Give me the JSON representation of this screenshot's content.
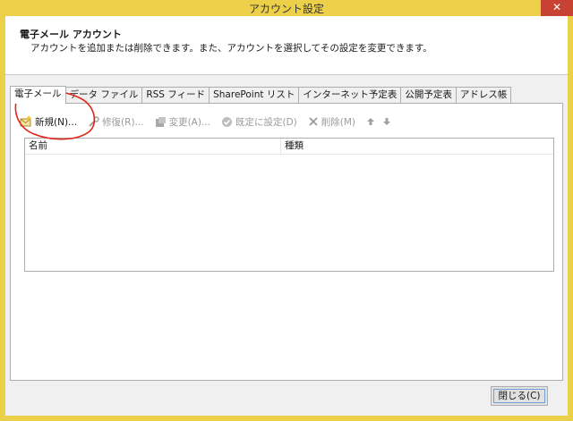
{
  "window": {
    "title": "アカウント設定",
    "close_glyph": "✕"
  },
  "header": {
    "title": "電子メール アカウント",
    "description": "アカウントを追加または削除できます。また、アカウントを選択してその設定を変更できます。"
  },
  "tabs": [
    {
      "label": "電子メール"
    },
    {
      "label": "データ ファイル"
    },
    {
      "label": "RSS フィード"
    },
    {
      "label": "SharePoint リスト"
    },
    {
      "label": "インターネット予定表"
    },
    {
      "label": "公開予定表"
    },
    {
      "label": "アドレス帳"
    }
  ],
  "toolbar": {
    "new_label": "新規(N)...",
    "repair_label": "修復(R)...",
    "change_label": "変更(A)...",
    "default_label": "既定に設定(D)",
    "delete_label": "削除(M)"
  },
  "list": {
    "columns": [
      "名前",
      "種類"
    ]
  },
  "footer": {
    "close_label": "閉じる(C)"
  },
  "colors": {
    "titlebar": "#ecd04a",
    "annotation": "#e0251b"
  }
}
